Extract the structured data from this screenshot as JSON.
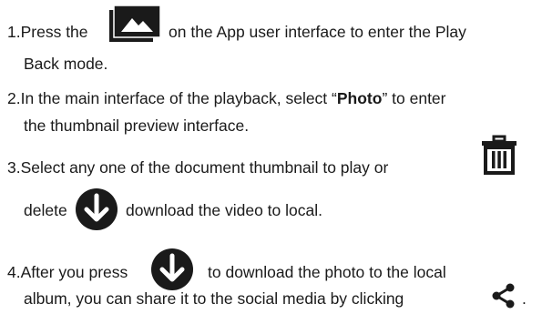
{
  "steps": [
    {
      "lines": [
        {
          "before": "1.Press the",
          "after": "on the App user interface to enter the Play"
        },
        {
          "text": "Back mode."
        }
      ],
      "icon": "gallery-icon"
    },
    {
      "lines": [
        {
          "before": "2.In the main interface of the playback, select “",
          "bold": "Photo",
          "after": "” to enter"
        },
        {
          "text": "the thumbnail preview interface."
        }
      ]
    },
    {
      "lines": [
        {
          "before": "3.Select any one of the document thumbnail to play or"
        },
        {
          "before": "delete",
          "after": "download the video to local."
        }
      ],
      "icons": [
        "trash-icon",
        "download-icon"
      ]
    },
    {
      "lines": [
        {
          "before": "4.After you press",
          "after": "to download the photo to the local"
        },
        {
          "before": "album, you can share it to the social media by clicking",
          "after": "."
        }
      ],
      "icons": [
        "download-icon",
        "share-icon"
      ]
    }
  ],
  "colors": {
    "text": "#1a1a1a",
    "icon": "#1a1a1a",
    "icon_glyph": "#ffffff"
  }
}
